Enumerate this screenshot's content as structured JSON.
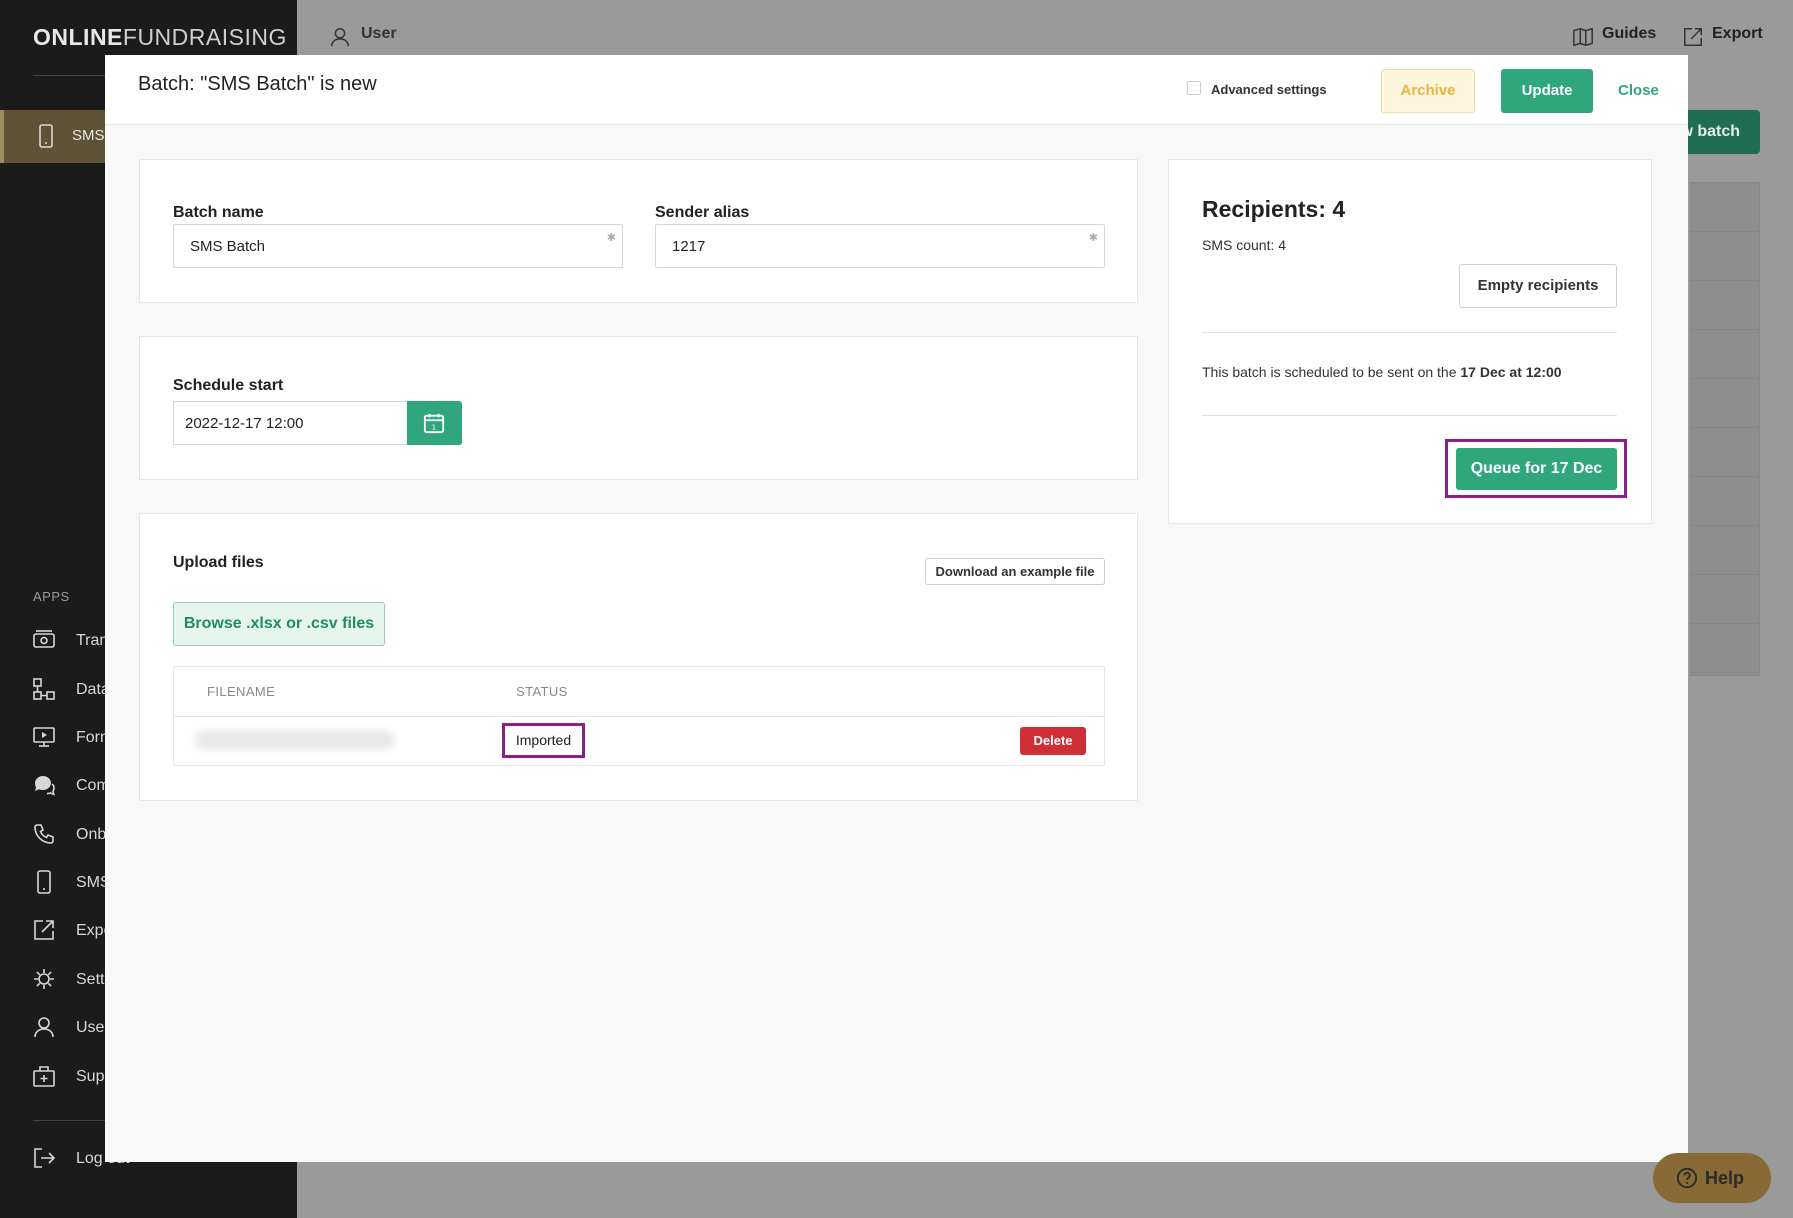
{
  "app": {
    "logo_bold": "ONLINE",
    "logo_light": "FUNDRAISING"
  },
  "topbar": {
    "user_label": "User",
    "guides_label": "Guides",
    "export_label": "Export",
    "new_batch_label": "w batch"
  },
  "sidebar": {
    "active_label": "SMS",
    "apps_heading": "APPS",
    "items": [
      {
        "label": "Tran",
        "icon": "transactions-icon"
      },
      {
        "label": "Data",
        "icon": "data-icon"
      },
      {
        "label": "Forn",
        "icon": "forms-icon"
      },
      {
        "label": "Com",
        "icon": "comments-icon"
      },
      {
        "label": "Onb",
        "icon": "phone-icon"
      },
      {
        "label": "SMS",
        "icon": "mobile-icon"
      },
      {
        "label": "Expo",
        "icon": "export-icon"
      },
      {
        "label": "Setti",
        "icon": "gear-icon"
      },
      {
        "label": "User",
        "icon": "user-icon"
      },
      {
        "label": "Supp",
        "icon": "support-icon"
      }
    ],
    "logout_label": "Log out"
  },
  "modal": {
    "title": "Batch: \"SMS Batch\" is new",
    "advanced_settings_label": "Advanced settings",
    "archive_label": "Archive",
    "update_label": "Update",
    "close_label": "Close"
  },
  "details": {
    "batch_name_label": "Batch name",
    "batch_name_value": "SMS Batch",
    "sender_alias_label": "Sender alias",
    "sender_alias_value": "1217"
  },
  "schedule": {
    "label": "Schedule start",
    "value": "2022-12-17 12:00"
  },
  "upload": {
    "label": "Upload files",
    "download_example_label": "Download an example file",
    "browse_label": "Browse .xlsx or .csv files",
    "columns": [
      "FILENAME",
      "STATUS"
    ],
    "rows": [
      {
        "status": "Imported",
        "delete_label": "Delete"
      }
    ]
  },
  "recipients": {
    "title": "Recipients: 4",
    "sms_count": "SMS count: 4",
    "empty_label": "Empty recipients",
    "schedule_prefix": "This batch is scheduled to be sent on the ",
    "schedule_when": "17 Dec at 12:00",
    "queue_label": "Queue for 17 Dec"
  },
  "help": {
    "label": "Help"
  },
  "colors": {
    "accent_green": "#2fa67c",
    "highlight_purple": "#8b1f8a",
    "danger_red": "#cf2f37",
    "archive_yellow": "#e8b540"
  }
}
